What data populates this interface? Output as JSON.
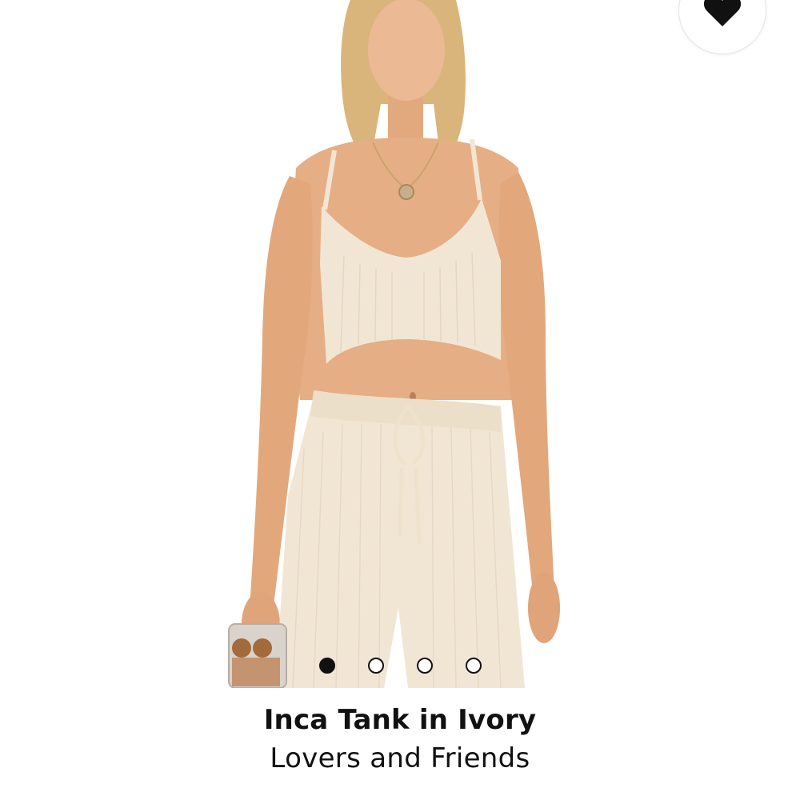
{
  "product": {
    "title": "Inca Tank in Ivory",
    "brand": "Lovers and Friends"
  },
  "gallery": {
    "slide_count": 4,
    "active_index": 0
  },
  "icons": {
    "wishlist": "heart-icon"
  },
  "colors": {
    "text": "#111111",
    "background": "#ffffff",
    "garment": "#f1e6d4",
    "skin": "#e8b48a"
  }
}
